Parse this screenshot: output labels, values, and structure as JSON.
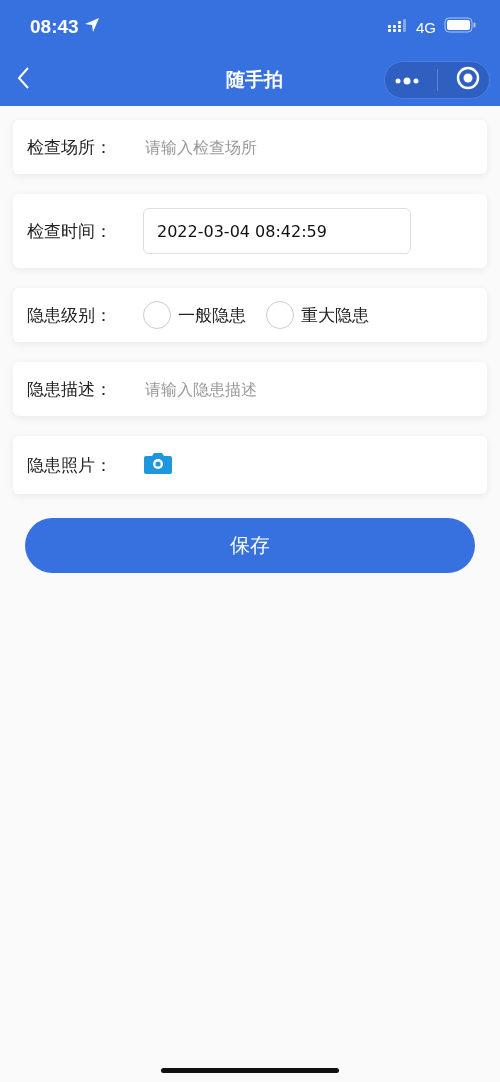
{
  "status_bar": {
    "time": "08:43",
    "network": "4G"
  },
  "nav": {
    "title": "随手拍"
  },
  "fields": [
    {
      "kind": "text",
      "label": "检查场所：",
      "placeholder": "请输入检查场所"
    },
    {
      "kind": "datetime",
      "label": "检查时间：",
      "value": "2022-03-04 08:42:59"
    },
    {
      "kind": "radio",
      "label": "隐患级别：",
      "options": [
        {
          "label": "一般隐患",
          "selected": false
        },
        {
          "label": "重大隐患",
          "selected": false
        }
      ]
    },
    {
      "kind": "text",
      "label": "隐患描述：",
      "placeholder": "请输入隐患描述"
    },
    {
      "kind": "photo",
      "label": "隐患照片："
    }
  ],
  "save_button": "保存"
}
